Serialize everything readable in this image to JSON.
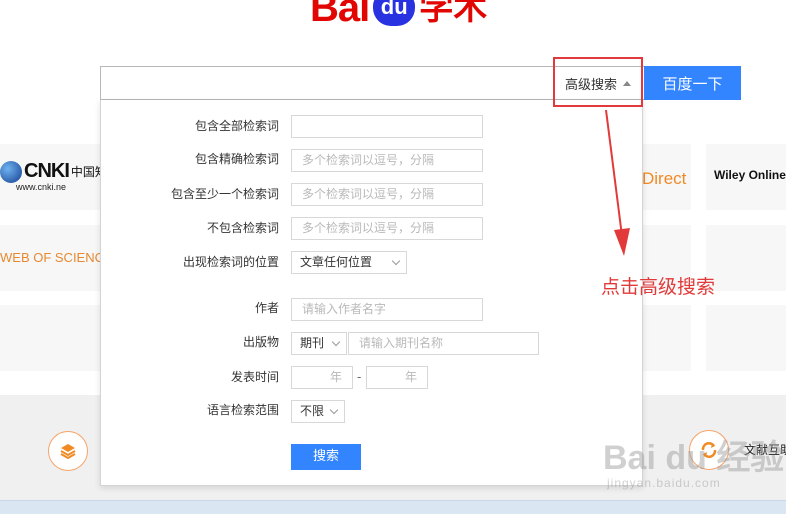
{
  "logo": {
    "left": "Bai",
    "paw": "du",
    "right": "学术"
  },
  "search": {
    "query": "",
    "advanced_label": "高级搜索",
    "button_label": "百度一下"
  },
  "sources": {
    "cnki_brand": "CNKI",
    "cnki_cn": "中国知",
    "cnki_url": "www.cnki.ne",
    "wos": "WEB OF SCIENCE",
    "direct": "Direct",
    "wiley": "Wiley Online"
  },
  "advanced": {
    "rows": [
      {
        "label": "包含全部检索词",
        "placeholder": ""
      },
      {
        "label": "包含精确检索词",
        "placeholder": "多个检索词以逗号，分隔"
      },
      {
        "label": "包含至少一个检索词",
        "placeholder": "多个检索词以逗号，分隔"
      },
      {
        "label": "不包含检索词",
        "placeholder": "多个检索词以逗号，分隔"
      }
    ],
    "position": {
      "label": "出现检索词的位置",
      "value": "文章任何位置"
    },
    "author": {
      "label": "作者",
      "placeholder": "请输入作者名字"
    },
    "publication": {
      "label": "出版物",
      "type": "期刊",
      "placeholder": "请输入期刊名称"
    },
    "time": {
      "label": "发表时间",
      "from": "年",
      "to": "年",
      "dash": "-"
    },
    "language": {
      "label": "语言检索范围",
      "value": "不限"
    },
    "submit": "搜索"
  },
  "footer": {
    "doc_help": "文献互助"
  },
  "annotation": {
    "text": "点击高级搜索"
  },
  "watermark": {
    "big": "Bai du 经验",
    "small": "jingyan.baidu.com"
  },
  "colors": {
    "accent": "#3385ff",
    "annotation": "#e23a3a",
    "brand_red": "#e10601",
    "brand_blue": "#2932e1"
  },
  "icons": [
    "stack-icon",
    "refresh-icon",
    "triangle-up-icon",
    "chevron-down-icon",
    "arrow-icon"
  ]
}
